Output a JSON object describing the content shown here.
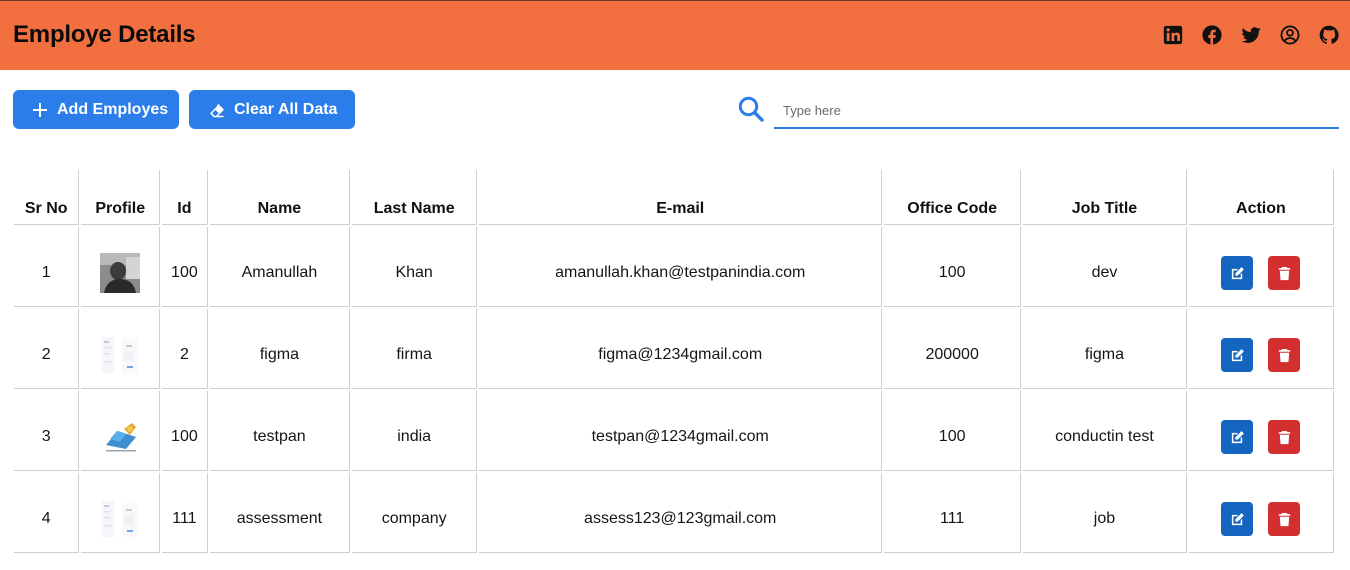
{
  "header": {
    "title": "Employe Details",
    "social_icons": [
      "linkedin-icon",
      "facebook-icon",
      "twitter-icon",
      "account-icon",
      "github-icon"
    ]
  },
  "toolbar": {
    "add_label": "Add Employes",
    "clear_label": "Clear All Data"
  },
  "search": {
    "placeholder": "Type here",
    "value": ""
  },
  "table": {
    "columns": [
      "Sr No",
      "Profile",
      "Id",
      "Name",
      "Last Name",
      "E-mail",
      "Office Code",
      "Job Title",
      "Action"
    ],
    "rows": [
      {
        "sr": "1",
        "profile": "photo",
        "id": "100",
        "name": "Amanullah",
        "last_name": "Khan",
        "email": "amanullah.khan@testpanindia.com",
        "office_code": "100",
        "job_title": "dev"
      },
      {
        "sr": "2",
        "profile": "document",
        "id": "2",
        "name": "figma",
        "last_name": "firma",
        "email": "figma@1234gmail.com",
        "office_code": "200000",
        "job_title": "figma"
      },
      {
        "sr": "3",
        "profile": "logo",
        "id": "100",
        "name": "testpan",
        "last_name": "india",
        "email": "testpan@1234gmail.com",
        "office_code": "100",
        "job_title": "conductin test"
      },
      {
        "sr": "4",
        "profile": "document",
        "id": "111",
        "name": "assessment",
        "last_name": "company",
        "email": "assess123@123gmail.com",
        "office_code": "111",
        "job_title": "job"
      }
    ]
  },
  "colors": {
    "header_bg": "#f2703f",
    "primary": "#2b7de9",
    "edit": "#1565c0",
    "delete": "#d32f2f"
  }
}
